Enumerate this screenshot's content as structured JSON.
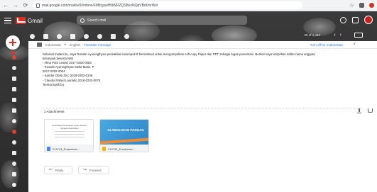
{
  "browser": {
    "back_icon": "back-arrow-icon",
    "url": "mail.google.com/mail/u/0/#inbox/FMfcgxwHNWRZQSBxxNQpVBrKmrWxt"
  },
  "header": {
    "app_name": "Gmail",
    "search_placeholder": "Search mail"
  },
  "toolbar": {
    "counter": "20 of 1,442"
  },
  "translate": {
    "from": "Indonesian",
    "arrow": "▸",
    "to": "English",
    "link": "Translate message",
    "turn_off": "Turn off for: Indonesian"
  },
  "email": {
    "lines": [
      "Selamat malam bu, saya Rosalin Ayuningthyas perwakilan kelompok 8 bermaksud untuk mengumpulkan soft copy Paper dan PPT sebagai tugas presentasi. Berikut saya lampirkan daftar nama anggota",
      "kelompok beserta NIM",
      "- Alina Putri Lestari 2017-0202-0083",
      "- Rosalin Ayuningthyas Stella Maris. P",
      "  2017-0202-0004",
      "- Sander Obda Zico 2018-0202-0106",
      "- Claudio Rafael Laurialto 2018-0202-0075",
      "Terima kasih bu"
    ]
  },
  "attachments": {
    "title": "2 Attachments",
    "items": [
      {
        "name": "214743_Presentasi...",
        "type": "doc",
        "preview_heading": "Keterkaitan Pola Gaya Hidup Modern dengan Kesehatan"
      },
      {
        "name": "214743_Presentasi...",
        "type": "ppt",
        "preview_title": "GLOBALISASI PANGAN"
      }
    ]
  },
  "actions": {
    "reply": "Reply",
    "forward": "Forward"
  },
  "colors": {
    "gmail_red": "#d93025",
    "link_blue": "#1a73e8",
    "slide_blue": "#2e86c8",
    "slide_orange": "#f28b30"
  }
}
